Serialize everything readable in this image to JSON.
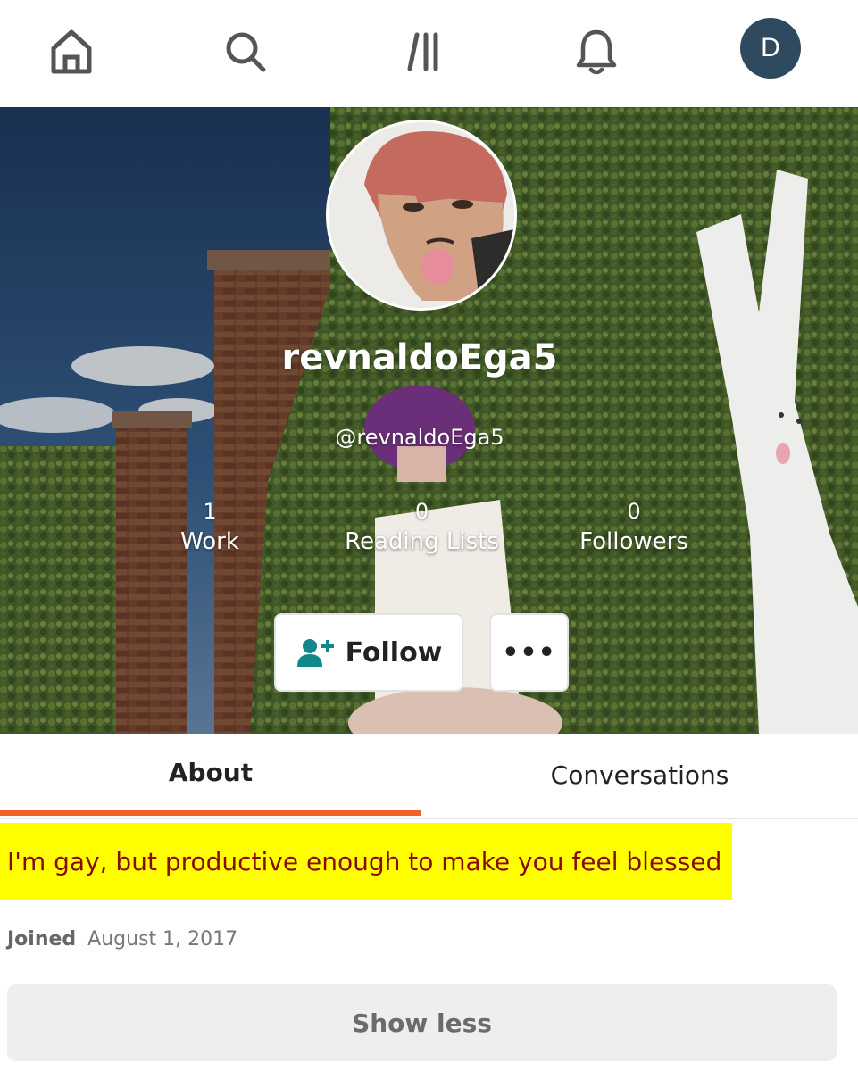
{
  "nav": {
    "items": [
      {
        "icon": "home-icon"
      },
      {
        "icon": "search-icon"
      },
      {
        "icon": "library-icon",
        "text": "/II"
      },
      {
        "icon": "bell-icon"
      }
    ],
    "user_avatar_initial": "D",
    "avatar_color": "#2f4a5e"
  },
  "profile": {
    "display_name": "revnaldoEga5",
    "handle": "@revnaldoEga5",
    "stats": [
      {
        "value": "1",
        "label": "Work"
      },
      {
        "value": "0",
        "label": "Reading Lists"
      },
      {
        "value": "0",
        "label": "Followers"
      }
    ],
    "follow_label": "Follow",
    "more_label": "•••"
  },
  "tabs": {
    "about": "About",
    "conversations": "Conversations",
    "active_color": "#f2612a"
  },
  "about": {
    "bio": "I'm gay, but productive enough to make you feel blessed",
    "joined_label": "Joined",
    "joined_date": "August 1, 2017",
    "show_less": "Show less",
    "highlight_color": "#ffff00",
    "bio_text_color": "#8a0a0a"
  }
}
